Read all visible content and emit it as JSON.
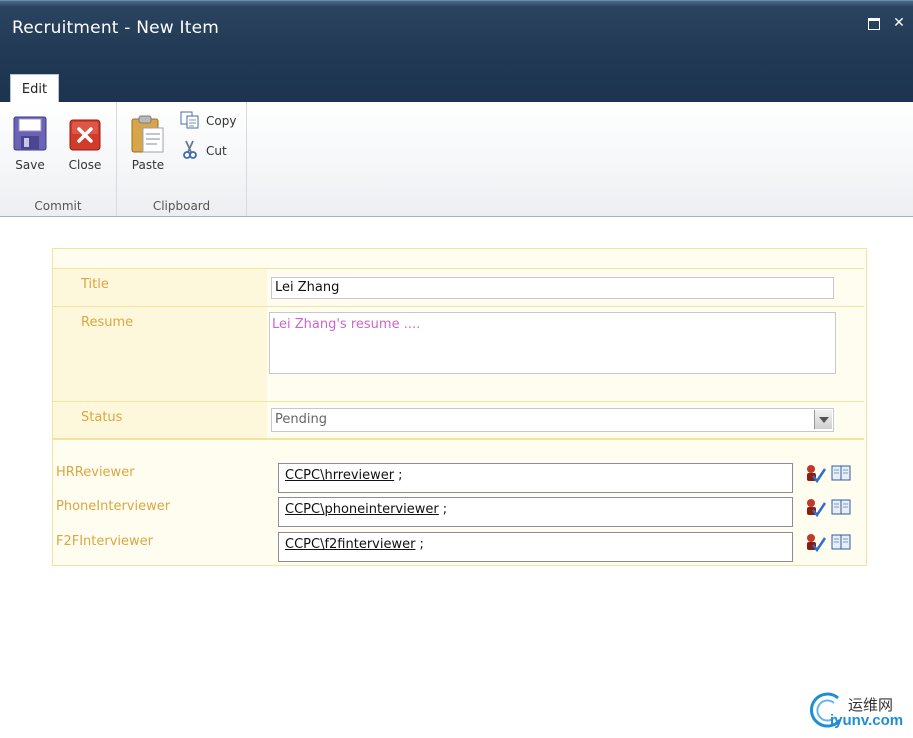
{
  "window": {
    "title": "Recruitment - New Item",
    "close_glyph": "✕"
  },
  "ribbon": {
    "tabs": [
      {
        "label": "Edit"
      }
    ],
    "groups": {
      "commit": {
        "label": "Commit",
        "save_label": "Save",
        "close_label": "Close"
      },
      "clipboard": {
        "label": "Clipboard",
        "paste_label": "Paste",
        "copy_label": "Copy",
        "cut_label": "Cut"
      }
    }
  },
  "form": {
    "title": {
      "label": "Title",
      "value": "Lei Zhang"
    },
    "resume": {
      "label": "Resume",
      "value": "Lei Zhang's resume ...."
    },
    "status": {
      "label": "Status",
      "value": "Pending"
    },
    "people": [
      {
        "label": "HRReviewer",
        "value": "CCPC\\hrreviewer",
        "separator": ";"
      },
      {
        "label": "PhoneInterviewer",
        "value": "CCPC\\phoneinterviewer",
        "separator": ";"
      },
      {
        "label": "F2FInterviewer",
        "value": "CCPC\\f2finterviewer",
        "separator": ";"
      }
    ]
  },
  "watermark": {
    "cn": "运维网",
    "en": "iyunv.com"
  },
  "icons": {
    "save": "floppy-disk-icon",
    "close": "red-x-icon",
    "paste": "clipboard-icon",
    "copy": "copy-pages-icon",
    "cut": "scissors-icon",
    "check_names": "check-names-icon",
    "browse": "address-book-icon"
  },
  "colors": {
    "titlebar": "#223a55",
    "field_label": "#d9a743",
    "form_bg": "#fffdf0",
    "form_border": "#f2e49a",
    "resume_text": "#cc66cc"
  }
}
